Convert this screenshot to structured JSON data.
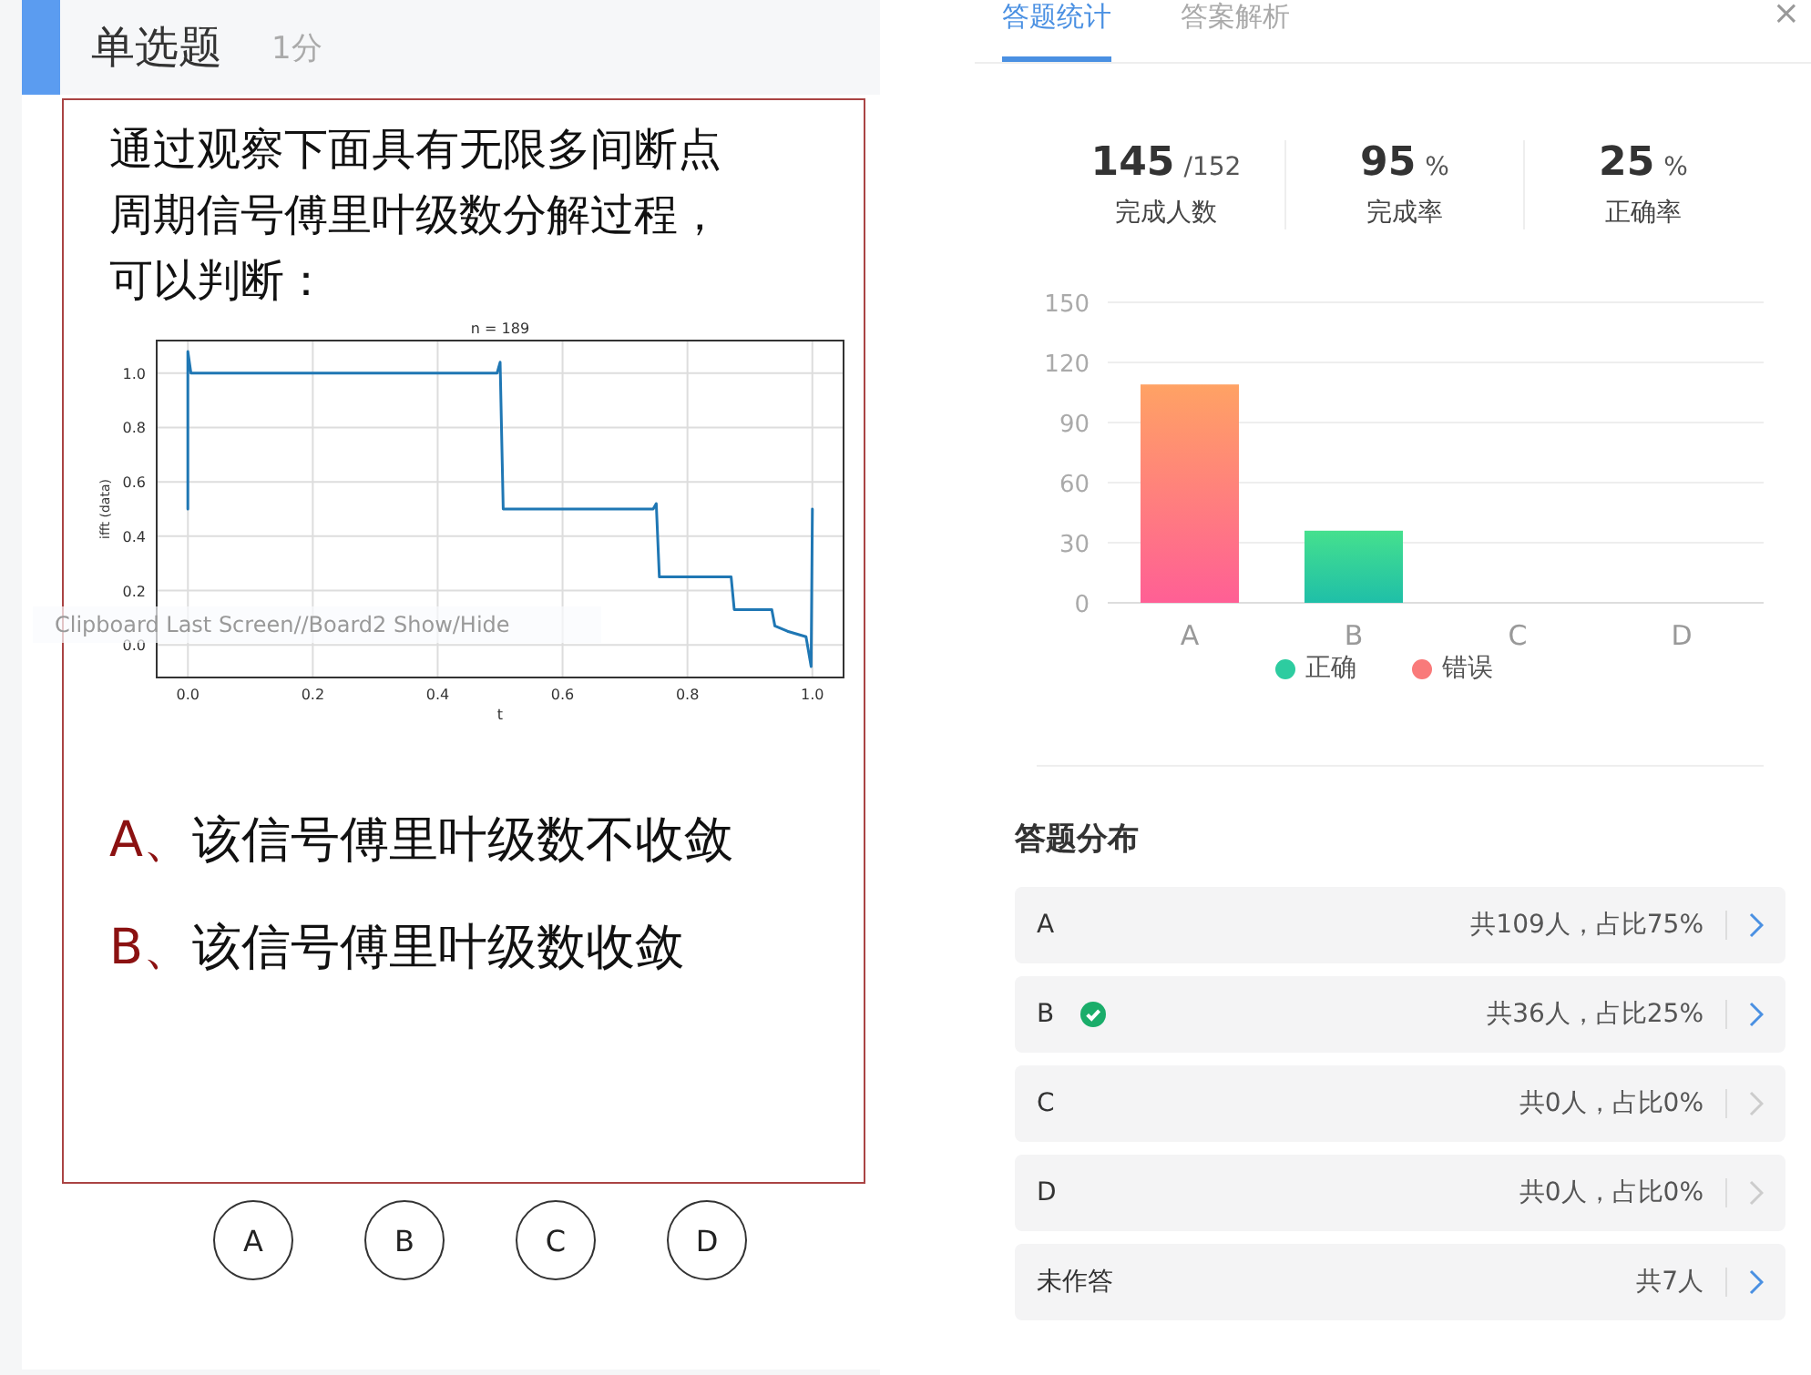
{
  "question": {
    "type": "单选题",
    "score": "1分",
    "slide": {
      "prompt_lines": [
        "通过观察下面具有无限多间断点",
        "周期信号傅里叶级数分解过程，",
        "可以判断："
      ],
      "plot": {
        "chart_data": {
          "type": "line",
          "title": "n = 189",
          "xlabel": "t",
          "ylabel": "ifft (data)",
          "xlim": [
            -0.05,
            1.05
          ],
          "ylim": [
            -0.12,
            1.12
          ],
          "xticks": [
            {
              "value": 0,
              "label": "0.0"
            },
            0.2,
            0.4,
            0.6,
            0.8,
            {
              "value": 1,
              "label": "1.0"
            }
          ],
          "yticks": [
            {
              "value": 0,
              "label": "0.0"
            },
            0.2,
            0.4,
            0.6,
            0.8,
            {
              "value": 1,
              "label": "1.0"
            }
          ],
          "x": [
            0,
            0,
            0.005,
            0.495,
            0.5,
            0.505,
            0.745,
            0.75,
            0.755,
            0.87,
            0.875,
            0.88,
            0.935,
            0.94,
            0.96,
            0.99,
            0.998,
            1.0
          ],
          "grid": true,
          "series": [
            {
              "color": "#1f77b4",
              "values": [
                0.5,
                1.08,
                1.0,
                1.0,
                1.04,
                0.5,
                0.5,
                0.52,
                0.25,
                0.25,
                0.13,
                0.13,
                0.13,
                0.07,
                0.05,
                0.03,
                -0.08,
                0.5
              ]
            }
          ]
        }
      },
      "options": [
        {
          "letter": "A、",
          "text": "该信号傅里叶级数不收敛"
        },
        {
          "letter": "B、",
          "text": "该信号傅里叶级数收敛"
        }
      ]
    },
    "answer_buttons": [
      "A",
      "B",
      "C",
      "D"
    ],
    "overlay_hint": "Clipboard Last Screen//Board2 Show/Hide"
  },
  "panel": {
    "tabs": [
      {
        "label": "答题统计",
        "selected": true
      },
      {
        "label": "答案解析",
        "selected": false
      }
    ],
    "close": "×",
    "stats": [
      {
        "value": "145",
        "unit": "/152",
        "label": "完成人数"
      },
      {
        "value": "95",
        "unit": "%",
        "label": "完成率"
      },
      {
        "value": "25",
        "unit": "%",
        "label": "正确率"
      }
    ],
    "chart_data": {
      "type": "bar",
      "stacked": true,
      "grid": true,
      "legend": true,
      "categories": [
        "A",
        "B",
        "C",
        "D"
      ],
      "ylim": [
        0,
        150
      ],
      "yticks": [
        0,
        30,
        60,
        90,
        120,
        150
      ],
      "series": [
        {
          "name": "正确",
          "color": "#2dcca0",
          "values": [
            0,
            36,
            0,
            0
          ]
        },
        {
          "name": "错误",
          "color": "#f97a7a",
          "values": [
            109,
            0,
            0,
            0
          ]
        }
      ]
    },
    "distribution_title": "答题分布",
    "rows": [
      {
        "label": "A",
        "correct": false,
        "summary": "共109人，占比75%",
        "disabled": false
      },
      {
        "label": "B",
        "correct": true,
        "summary": "共36人，占比25%",
        "disabled": false
      },
      {
        "label": "C",
        "correct": false,
        "summary": "共0人，占比0%",
        "disabled": true
      },
      {
        "label": "D",
        "correct": false,
        "summary": "共0人，占比0%",
        "disabled": true
      },
      {
        "label": "未作答",
        "correct": false,
        "summary": "共7人",
        "disabled": false
      }
    ]
  }
}
